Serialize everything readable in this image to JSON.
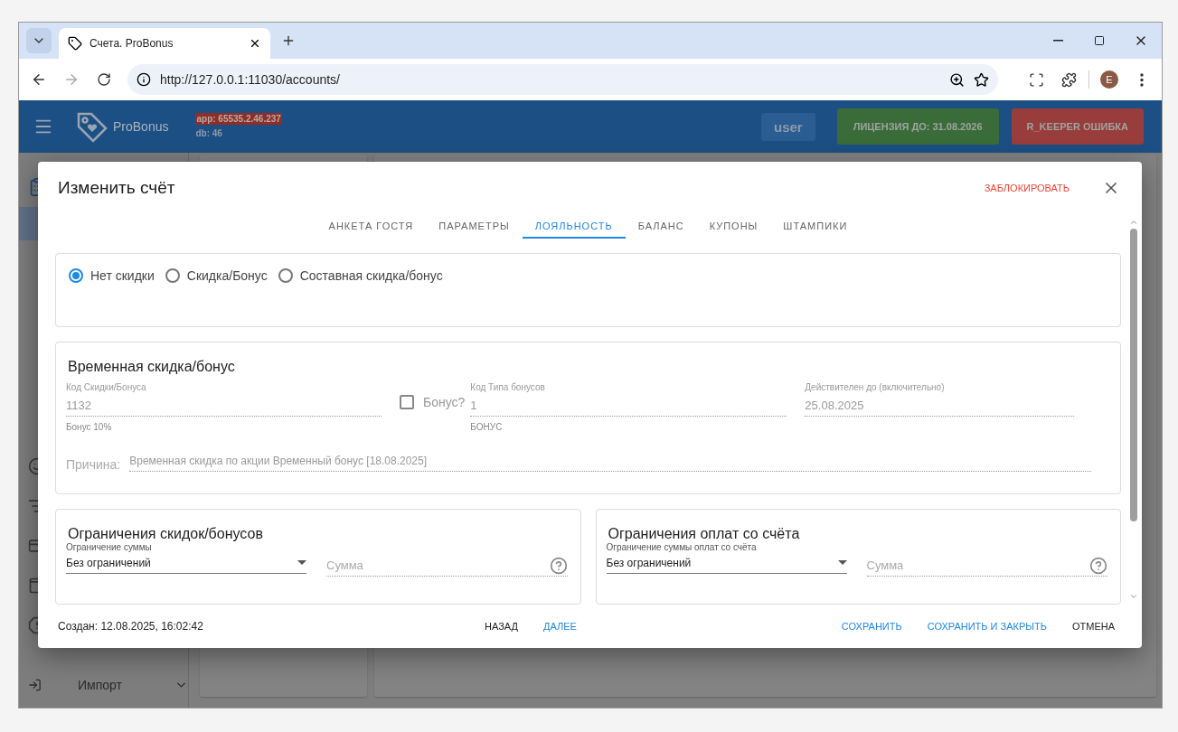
{
  "browser": {
    "tab_title": "Счета. ProBonus",
    "url": "http://127.0.0.1:11030/accounts/",
    "profile_initial": "E"
  },
  "header": {
    "app_name": "ProBonus",
    "app_version": "app: 65535.2.46.237",
    "db_version": "db: 46",
    "user": "user",
    "license": "ЛИЦЕНЗИЯ ДО: 31.08.2026",
    "rkeeper_status": "R_KEEPER ОШИБКА"
  },
  "sidebar": {
    "items": [
      {
        "selected": true
      }
    ],
    "import_label": "Импорт"
  },
  "dialog": {
    "title": "Изменить счёт",
    "block_action": "ЗАБЛОКИРОВАТЬ",
    "tabs": [
      {
        "label": "АНКЕТА ГОСТЯ",
        "selected": false
      },
      {
        "label": "ПАРАМЕТРЫ",
        "selected": false
      },
      {
        "label": "ЛОЯЛЬНОСТЬ",
        "selected": true
      },
      {
        "label": "БАЛАНС",
        "selected": false
      },
      {
        "label": "КУПОНЫ",
        "selected": false
      },
      {
        "label": "ШТАМПИКИ",
        "selected": false
      }
    ],
    "discount_mode": [
      {
        "label": "Нет скидки",
        "selected": true
      },
      {
        "label": "Скидка/Бонус",
        "selected": false
      },
      {
        "label": "Составная скидка/бонус",
        "selected": false
      }
    ],
    "temporary": {
      "title": "Временная скидка/бонус",
      "code": {
        "label": "Код Скидки/Бонуса",
        "value": "1132",
        "helper": "Бонус 10%"
      },
      "bonus_checkbox": {
        "label": "Бонус?",
        "checked": false
      },
      "bonus_type": {
        "label": "Код Типа бонусов",
        "value": "1",
        "helper": "БОНУС"
      },
      "valid_until": {
        "label": "Действителен до (включительно)",
        "value": "25.08.2025"
      },
      "reason": {
        "label": "Причина:",
        "value": "Временная скидка по акции Временный бонус [18.08.2025]"
      }
    },
    "limits": [
      {
        "title": "Ограничения скидок/бонусов",
        "select_label": "Ограничение суммы",
        "select_value": "Без ограничений",
        "amount_placeholder": "Сумма"
      },
      {
        "title": "Ограничения оплат со счёта",
        "select_label": "Ограничение суммы оплат со счёта",
        "select_value": "Без ограничений",
        "amount_placeholder": "Сумма"
      }
    ],
    "footer": {
      "created": "Создан: 12.08.2025, 16:02:42",
      "nav_buttons": [
        {
          "label": "НАЗАД",
          "kind": "plain"
        },
        {
          "label": "ДАЛЕЕ",
          "kind": "primary"
        }
      ],
      "actions": [
        {
          "label": "СОХРАНИТЬ",
          "kind": "primary"
        },
        {
          "label": "СОХРАНИТЬ И ЗАКРЫТЬ",
          "kind": "primary"
        },
        {
          "label": "ОТМЕНА",
          "kind": "plain"
        }
      ]
    }
  }
}
